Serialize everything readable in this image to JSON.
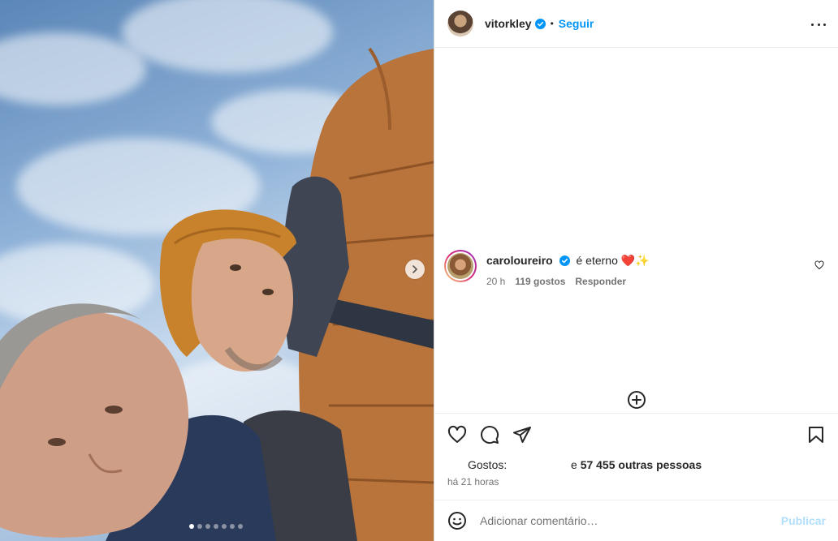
{
  "post": {
    "author": {
      "username": "vitorkley",
      "verified": true
    },
    "follow_label": "Seguir",
    "separator": "•",
    "carousel": {
      "slide_count": 7,
      "active_index": 0
    }
  },
  "comments": [
    {
      "username": "caroloureiro",
      "verified": true,
      "text": "é eterno ❤️✨",
      "time": "20 h",
      "likes": "119 gostos",
      "reply_label": "Responder"
    }
  ],
  "likes": {
    "label": "Gostos:",
    "prefix": "e",
    "count": "57 455 outras pessoas"
  },
  "timestamp": "há 21 horas",
  "composer": {
    "placeholder": "Adicionar comentário…",
    "publish_label": "Publicar"
  },
  "colors": {
    "link_blue": "#0095f6",
    "publish_disabled": "#b2dffc",
    "verified_blue": "#0095f6",
    "muted_text": "#737373"
  },
  "icons": [
    "next-icon",
    "more-icon",
    "verified-icon",
    "heart-icon",
    "comment-icon",
    "share-icon",
    "bookmark-icon",
    "plus-circle-icon",
    "emoji-icon"
  ]
}
